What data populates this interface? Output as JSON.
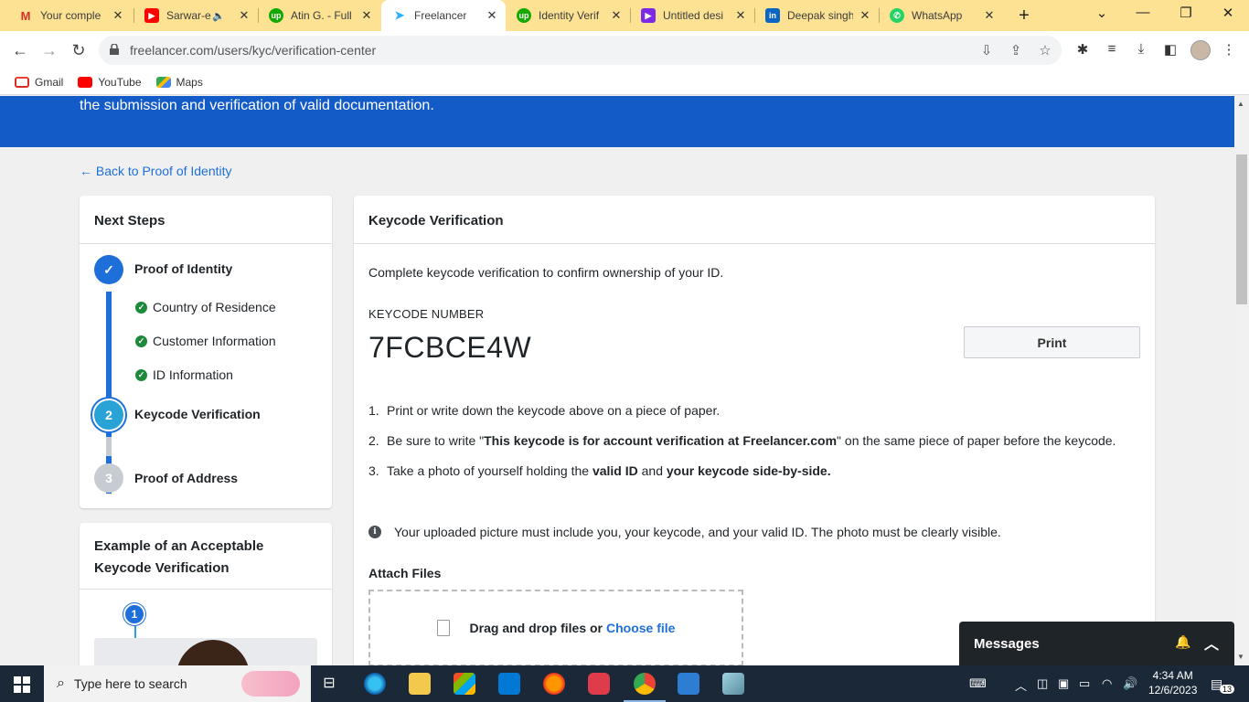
{
  "browser": {
    "tabs": [
      {
        "title": "Your comple",
        "icon": "gmail-icon",
        "color": "#d93025"
      },
      {
        "title": "Sarwar-e",
        "icon": "youtube-icon",
        "color": "#ff0000"
      },
      {
        "title": "Atin G. - Full",
        "icon": "upwork-icon",
        "color": "#14a800"
      },
      {
        "title": "Freelancer",
        "icon": "freelancer-icon",
        "color": "#29b2fe"
      },
      {
        "title": "Identity Verif",
        "icon": "upwork-icon",
        "color": "#14a800"
      },
      {
        "title": "Untitled desi",
        "icon": "canva-icon",
        "color": "#7d2ae8"
      },
      {
        "title": "Deepak singh",
        "icon": "linkedin-icon",
        "color": "#0a66c2"
      },
      {
        "title": "WhatsApp",
        "icon": "whatsapp-icon",
        "color": "#25d366"
      }
    ],
    "url": "freelancer.com/users/kyc/verification-center",
    "bookmarks": [
      "Gmail",
      "YouTube",
      "Maps"
    ]
  },
  "hero": {
    "text": "the submission and verification of valid documentation."
  },
  "back_link": "← Back to Proof of Identity",
  "steps": {
    "title": "Next Steps",
    "items": [
      {
        "label": "Proof of Identity",
        "marker": "✓",
        "state": "complete"
      },
      {
        "label": "Keycode Verification",
        "marker": "2",
        "state": "current"
      },
      {
        "label": "Proof of Address",
        "marker": "3",
        "state": "pending"
      }
    ],
    "sub_items": [
      "Country of Residence",
      "Customer Information",
      "ID Information"
    ]
  },
  "example": {
    "title": "Example of an Acceptable Keycode Verification",
    "marker": "1"
  },
  "main": {
    "title": "Keycode Verification",
    "intro": "Complete keycode verification to confirm ownership of your ID.",
    "keycode_label": "KEYCODE NUMBER",
    "keycode_value": "7FCBCE4W",
    "print_label": "Print",
    "instructions": [
      {
        "num": "1.",
        "parts": [
          "Print or write down the keycode above on a piece of paper."
        ]
      },
      {
        "num": "2.",
        "pre": "Be sure to write \"",
        "bold": "This keycode is for account verification at Freelancer.com",
        "post": "\" on the same piece of paper before the keycode."
      },
      {
        "num": "3.",
        "pre": "Take a photo of yourself holding the ",
        "bold1": "valid ID",
        "mid": " and ",
        "bold2": "your keycode side-by-side."
      }
    ],
    "notice": "Your uploaded picture must include you, your keycode, and your valid ID. The photo must be clearly visible.",
    "attach_title": "Attach Files",
    "dropzone_text": "Drag and drop files or",
    "choose_file": "Choose file"
  },
  "messages": {
    "label": "Messages"
  },
  "taskbar": {
    "search_placeholder": "Type here to search",
    "time": "4:34 AM",
    "date": "12/6/2023",
    "notifications": "13"
  },
  "colors": {
    "brand_blue": "#135cc7",
    "link_blue": "#1e6fd9",
    "step_complete": "#1e6fd9",
    "step_current": "#29a3d6",
    "step_pending": "#c7ccd3",
    "check_green": "#1d8a3b"
  }
}
